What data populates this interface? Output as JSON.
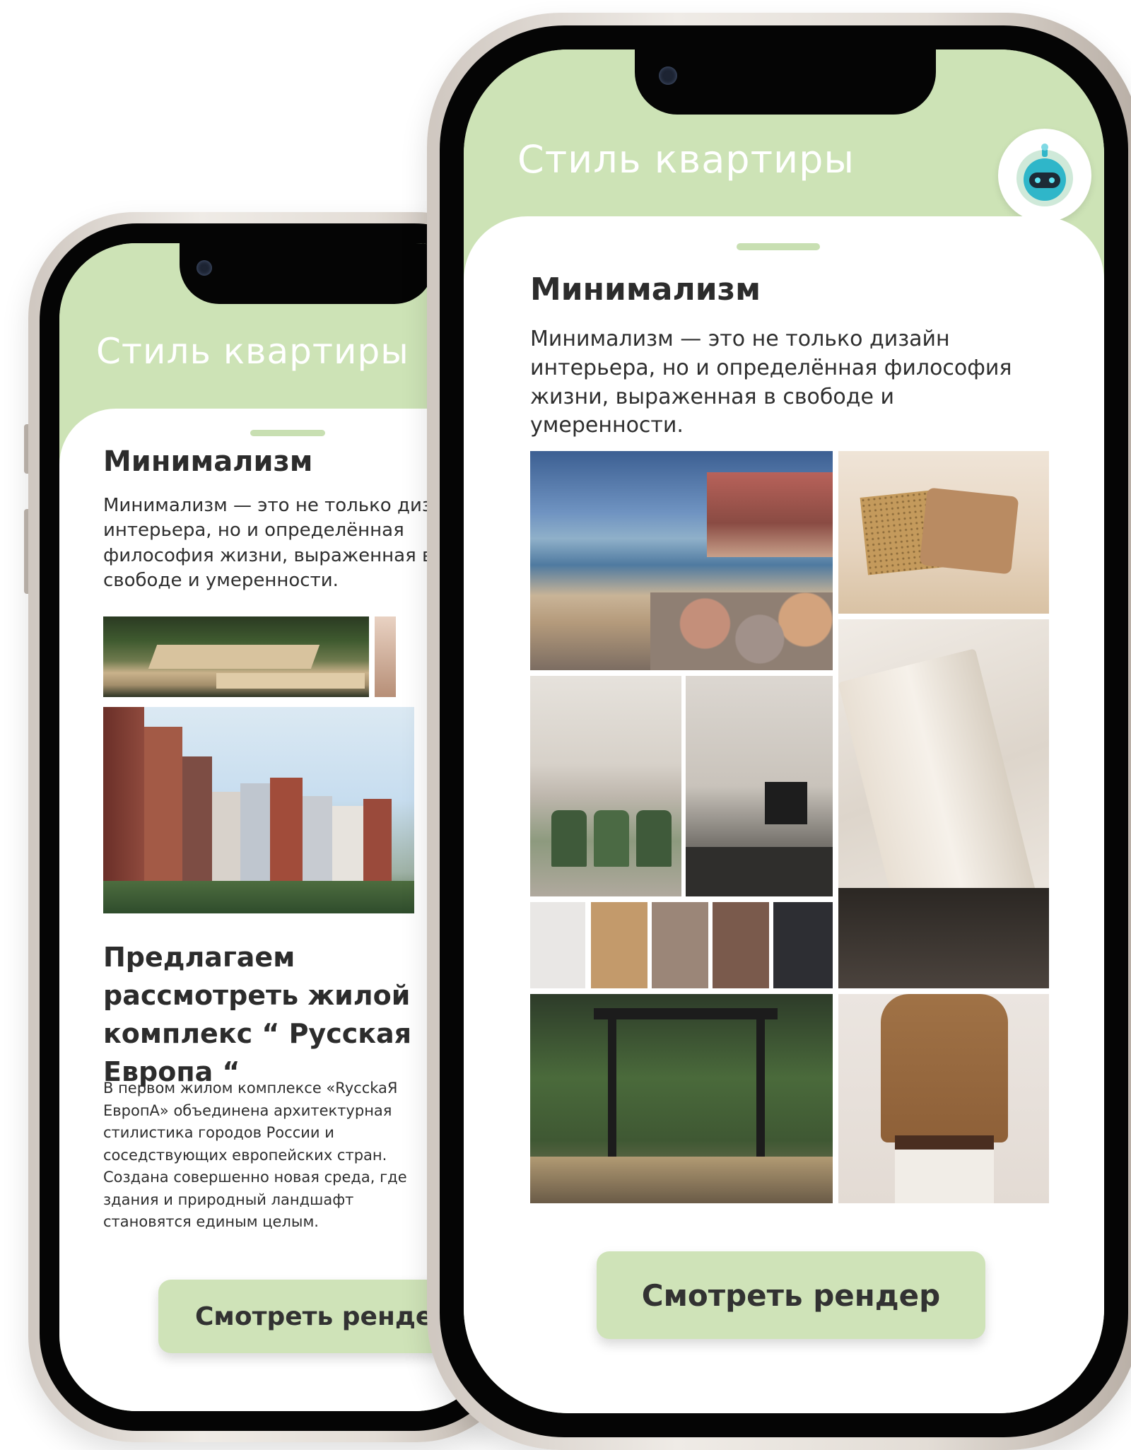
{
  "back_phone": {
    "header_title": "Стиль квартиры",
    "section_title": "Минимализм",
    "section_text": "Минимализм — это не только дизайн интерьера, но и определённая философия жизни, выраженная в свободе и умеренности.",
    "complex_title": "Предлагаем рассмотреть жилой комплекс “ Русская Европа “",
    "complex_text": "В первом жилом комплексе «RycckaЯ EвpoпA» объединена архитектурная стилистика городов России и соседствующих европейских стран. Создана совершенно новая среда, где здания и природный ландшафт становятся единым целым.",
    "cta_label": "Смотреть рендер"
  },
  "front_phone": {
    "header_title": "Стиль квартиры",
    "section_title": "Минимализм",
    "section_text": "Минимализм — это не только дизайн интерьера, но и определённая философия жизни, выраженная в свободе и умеренности.",
    "cta_label": "Смотреть рендер",
    "palette": [
      "#e9e7e5",
      "#c39a6b",
      "#9b8678",
      "#7a5a4c",
      "#2d2e33"
    ]
  },
  "colors": {
    "header_green": "#cde3b6",
    "button_green": "#cfe3b8",
    "handle_green": "#c8dfb2"
  }
}
